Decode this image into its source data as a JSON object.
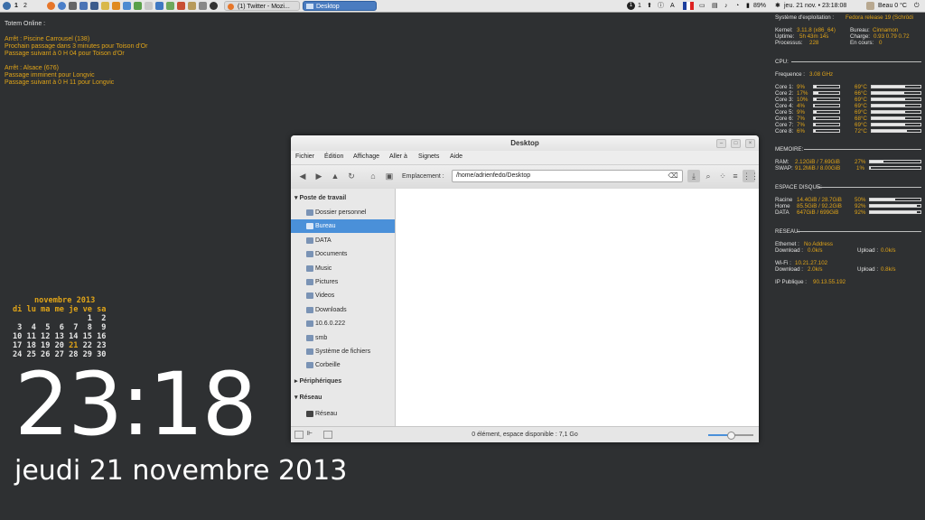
{
  "panel": {
    "workspaces": [
      "1",
      "2"
    ],
    "tasks": [
      {
        "label": "(1) Twitter - Mozi...",
        "active": false
      },
      {
        "label": "Desktop",
        "active": true
      }
    ],
    "notif_count": "1",
    "status_right": "1",
    "battery": "89%",
    "clock": "jeu. 21 nov. • 23:18:08",
    "weather": "Beau 0 °C"
  },
  "totem": {
    "title": "Totem Online :",
    "stop1": "Arrêt : Piscine Carrousel  (138)",
    "stop1_line1": "Prochain passage dans 3 minutes pour Toison d'Or",
    "stop1_line2": "Passage suivant à 0 H 04 pour Toison d'Or",
    "stop2": "Arrêt : Alsace  (676)",
    "stop2_line1": "Passage imminent pour Longvic",
    "stop2_line2": "Passage suivant à 0 H 11 pour Longvic"
  },
  "calendar": {
    "title": "novembre 2013",
    "weekdays": "di lu ma me je ve sa",
    "rows": [
      "                1  2",
      " 3  4  5  6  7  8  9",
      "10 11 12 13 14 15 16",
      "17 18 19 20 21 22 23",
      "24 25 26 27 28 29 30"
    ],
    "today": "21"
  },
  "clock": {
    "time": "23:18",
    "date": "jeudi 21 novembre 2013"
  },
  "conky": {
    "os_label": "Système d'exploitation :",
    "os_value": "Fedora release 19 (Schrödi",
    "kernel_label": "Kernel:",
    "kernel_value": "3.11.8 (x86_64)",
    "uptime_label": "Uptime:",
    "uptime_value": "5h 43m 14s",
    "proc_label": "Processus:",
    "proc_value": "228",
    "desktop_label": "Bureau:",
    "desktop_value": "Cinnamon",
    "load_label": "Charge:",
    "load_value": "0.93 0.79 0.72",
    "running_label": "En cours:",
    "running_value": "0",
    "cpu_header": "CPU:",
    "freq_label": "Frequence :",
    "freq_value": "3.08 GHz",
    "cores": [
      {
        "label": "Core 1:",
        "pct": "9%",
        "pct_val": 9,
        "temp": "69°C",
        "temp_val": 69
      },
      {
        "label": "Core 2:",
        "pct": "17%",
        "pct_val": 17,
        "temp": "66°C",
        "temp_val": 66
      },
      {
        "label": "Core 3:",
        "pct": "10%",
        "pct_val": 10,
        "temp": "69°C",
        "temp_val": 69
      },
      {
        "label": "Core 4:",
        "pct": "4%",
        "pct_val": 4,
        "temp": "69°C",
        "temp_val": 69
      },
      {
        "label": "Core 5:",
        "pct": "9%",
        "pct_val": 9,
        "temp": "69°C",
        "temp_val": 69
      },
      {
        "label": "Core 6:",
        "pct": "7%",
        "pct_val": 7,
        "temp": "68°C",
        "temp_val": 68
      },
      {
        "label": "Core 7:",
        "pct": "7%",
        "pct_val": 7,
        "temp": "69°C",
        "temp_val": 69
      },
      {
        "label": "Core 8:",
        "pct": "6%",
        "pct_val": 6,
        "temp": "72°C",
        "temp_val": 72
      }
    ],
    "mem_header": "MEMOIRE:",
    "ram_label": "RAM:",
    "ram_value": "2.12GiB / 7.69GiB",
    "ram_pct": "27%",
    "ram_pct_val": 27,
    "swap_label": "SWAP:",
    "swap_value": "91.2MiB / 8.00GiB",
    "swap_pct": "1%",
    "swap_pct_val": 1,
    "disk_header": "ESPACE DISQUE:",
    "disks": [
      {
        "label": "Racine",
        "value": "14.4GiB / 28.7GiB",
        "pct": "50%",
        "pct_val": 50
      },
      {
        "label": "Home",
        "value": "85.5GiB / 92.2GiB",
        "pct": "92%",
        "pct_val": 92
      },
      {
        "label": "DATA",
        "value": "647GiB / 699GiB",
        "pct": "92%",
        "pct_val": 92
      }
    ],
    "net_header": "RESEAU:",
    "eth_label": "Ethernet :",
    "eth_value": "No Address",
    "eth_dl_label": "Download :",
    "eth_dl": "0.0k/s",
    "eth_ul_label": "Upload :",
    "eth_ul": "0.0k/s",
    "wifi_label": "Wi-Fi :",
    "wifi_value": "10.21.27.102",
    "wifi_dl_label": "Download :",
    "wifi_dl": "2.0k/s",
    "wifi_ul_label": "Upload :",
    "wifi_ul": "0.8k/s",
    "ip_label": "IP Publique :",
    "ip_value": "90.13.55.192"
  },
  "window": {
    "title": "Desktop",
    "menu": [
      "Fichier",
      "Édition",
      "Affichage",
      "Aller à",
      "Signets",
      "Aide"
    ],
    "location_label": "Emplacement :",
    "location_value": "/home/adrienfedo/Desktop",
    "sidebar": {
      "places_header": "Poste de travail",
      "places": [
        {
          "label": "Dossier personnel",
          "icon": "home-folder-icon",
          "selected": false
        },
        {
          "label": "Bureau",
          "icon": "desktop-icon",
          "selected": true
        },
        {
          "label": "DATA",
          "icon": "folder-icon",
          "selected": false
        },
        {
          "label": "Documents",
          "icon": "folder-icon",
          "selected": false
        },
        {
          "label": "Music",
          "icon": "music-folder-icon",
          "selected": false
        },
        {
          "label": "Pictures",
          "icon": "pictures-folder-icon",
          "selected": false
        },
        {
          "label": "Videos",
          "icon": "videos-folder-icon",
          "selected": false
        },
        {
          "label": "Downloads",
          "icon": "downloads-folder-icon",
          "selected": false
        },
        {
          "label": "10.6.0.222",
          "icon": "folder-icon",
          "selected": false
        },
        {
          "label": "smb",
          "icon": "folder-icon",
          "selected": false
        },
        {
          "label": "Système de fichiers",
          "icon": "drive-icon",
          "selected": false
        },
        {
          "label": "Corbeille",
          "icon": "trash-icon",
          "selected": false
        }
      ],
      "devices_header": "Périphériques",
      "network_header": "Réseau",
      "network_items": [
        {
          "label": "Réseau",
          "icon": "network-icon"
        }
      ]
    },
    "status": "0 élément, espace disponible : 7,1 Go",
    "zoom": 0.5
  },
  "colors": {
    "accent": "#4a90d9",
    "conky_value": "#e0a418",
    "desktop": "#2e3032"
  }
}
